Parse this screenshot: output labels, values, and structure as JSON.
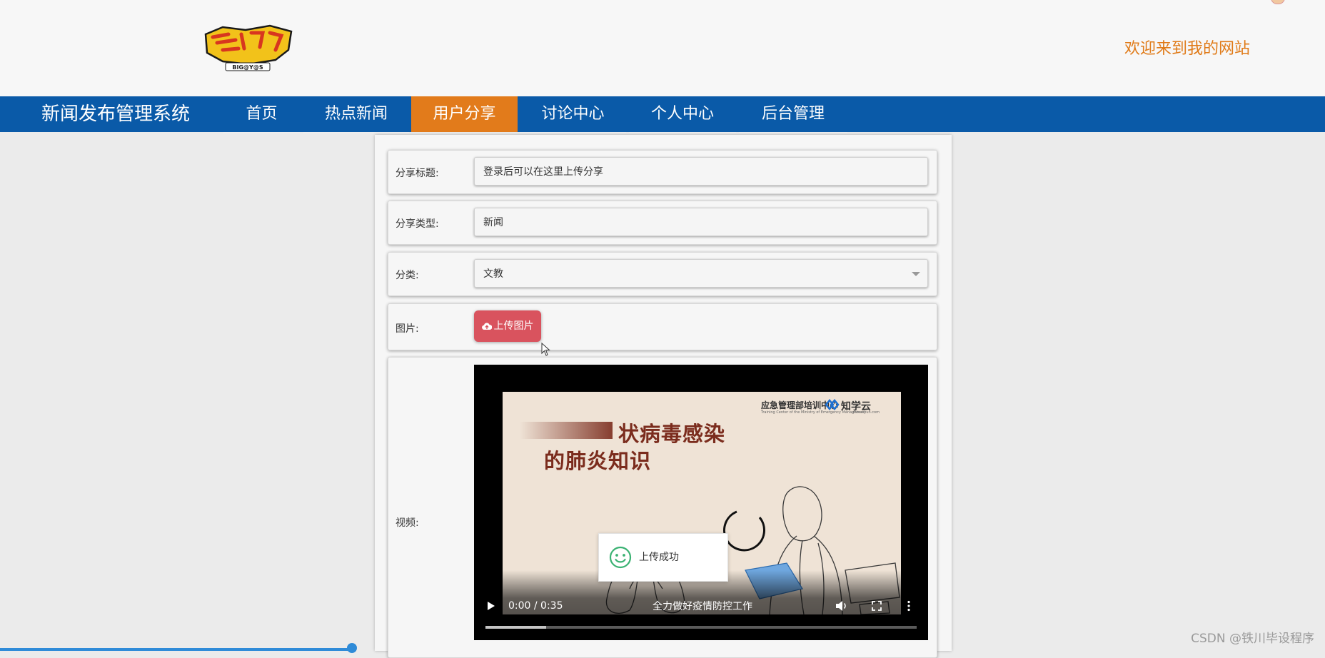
{
  "header": {
    "welcome": "欢迎来到我的网站",
    "logo_text": "BIG@Y@S"
  },
  "nav": {
    "brand": "新闻发布管理系统",
    "items": [
      {
        "label": "首页"
      },
      {
        "label": "热点新闻"
      },
      {
        "label": "用户分享",
        "active": true
      },
      {
        "label": "讨论中心"
      },
      {
        "label": "个人中心"
      },
      {
        "label": "后台管理"
      }
    ]
  },
  "form": {
    "title_label": "分享标题:",
    "title_value": "登录后可以在这里上传分享",
    "type_label": "分享类型:",
    "type_value": "新闻",
    "category_label": "分类:",
    "category_value": "文教",
    "image_label": "图片:",
    "image_button": "上传图片",
    "video_label": "视频:"
  },
  "video": {
    "headline_line1": "状病毒感染",
    "headline_line2": "的肺炎知识",
    "org_name": "应急管理部培训中心",
    "org_en": "Training Center of the Ministry of Emergency Management",
    "brand_name": "知学云",
    "brand_en": "zhixueyun.com",
    "time": "0:00 / 0:35",
    "subtitle": "全力做好疫情防控工作",
    "progress": 0.14
  },
  "toast": {
    "text": "上传成功"
  },
  "watermark": "CSDN @铁川毕设程序",
  "colors": {
    "nav_bg": "#0a5aa8",
    "nav_active": "#e27b1b",
    "welcome": "#e07a17",
    "upload_button": "#d9535e"
  }
}
